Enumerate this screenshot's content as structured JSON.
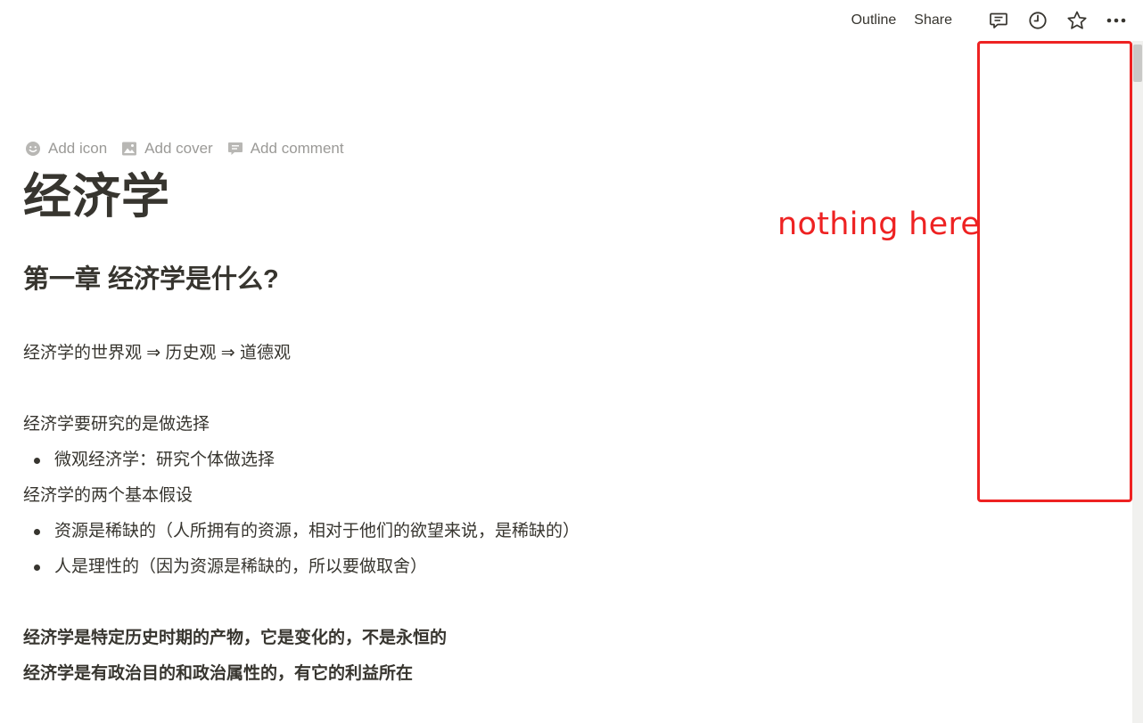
{
  "topbar": {
    "outline_label": "Outline",
    "share_label": "Share",
    "icons": [
      "comment-icon",
      "history-clock-icon",
      "star-icon",
      "more-dots-icon"
    ]
  },
  "page_controls": {
    "add_icon_label": "Add icon",
    "add_cover_label": "Add cover",
    "add_comment_label": "Add comment"
  },
  "page": {
    "title": "经济学",
    "heading": "第一章 经济学是什么?",
    "line1": "经济学的世界观 ⇒ 历史观 ⇒ 道德观",
    "line2": "经济学要研究的是做选择",
    "bullet1": "微观经济学：研究个体做选择",
    "line3": "经济学的两个基本假设",
    "bullet2": "资源是稀缺的（人所拥有的资源，相对于他们的欲望来说，是稀缺的）",
    "bullet3": "人是理性的（因为资源是稀缺的，所以要做取舍）",
    "bold1": "经济学是特定历史时期的产物，它是变化的，不是永恒的",
    "bold2": "经济学是有政治目的和政治属性的，有它的利益所在"
  },
  "annotation": {
    "text": "nothing here",
    "color": "#ee2222"
  }
}
